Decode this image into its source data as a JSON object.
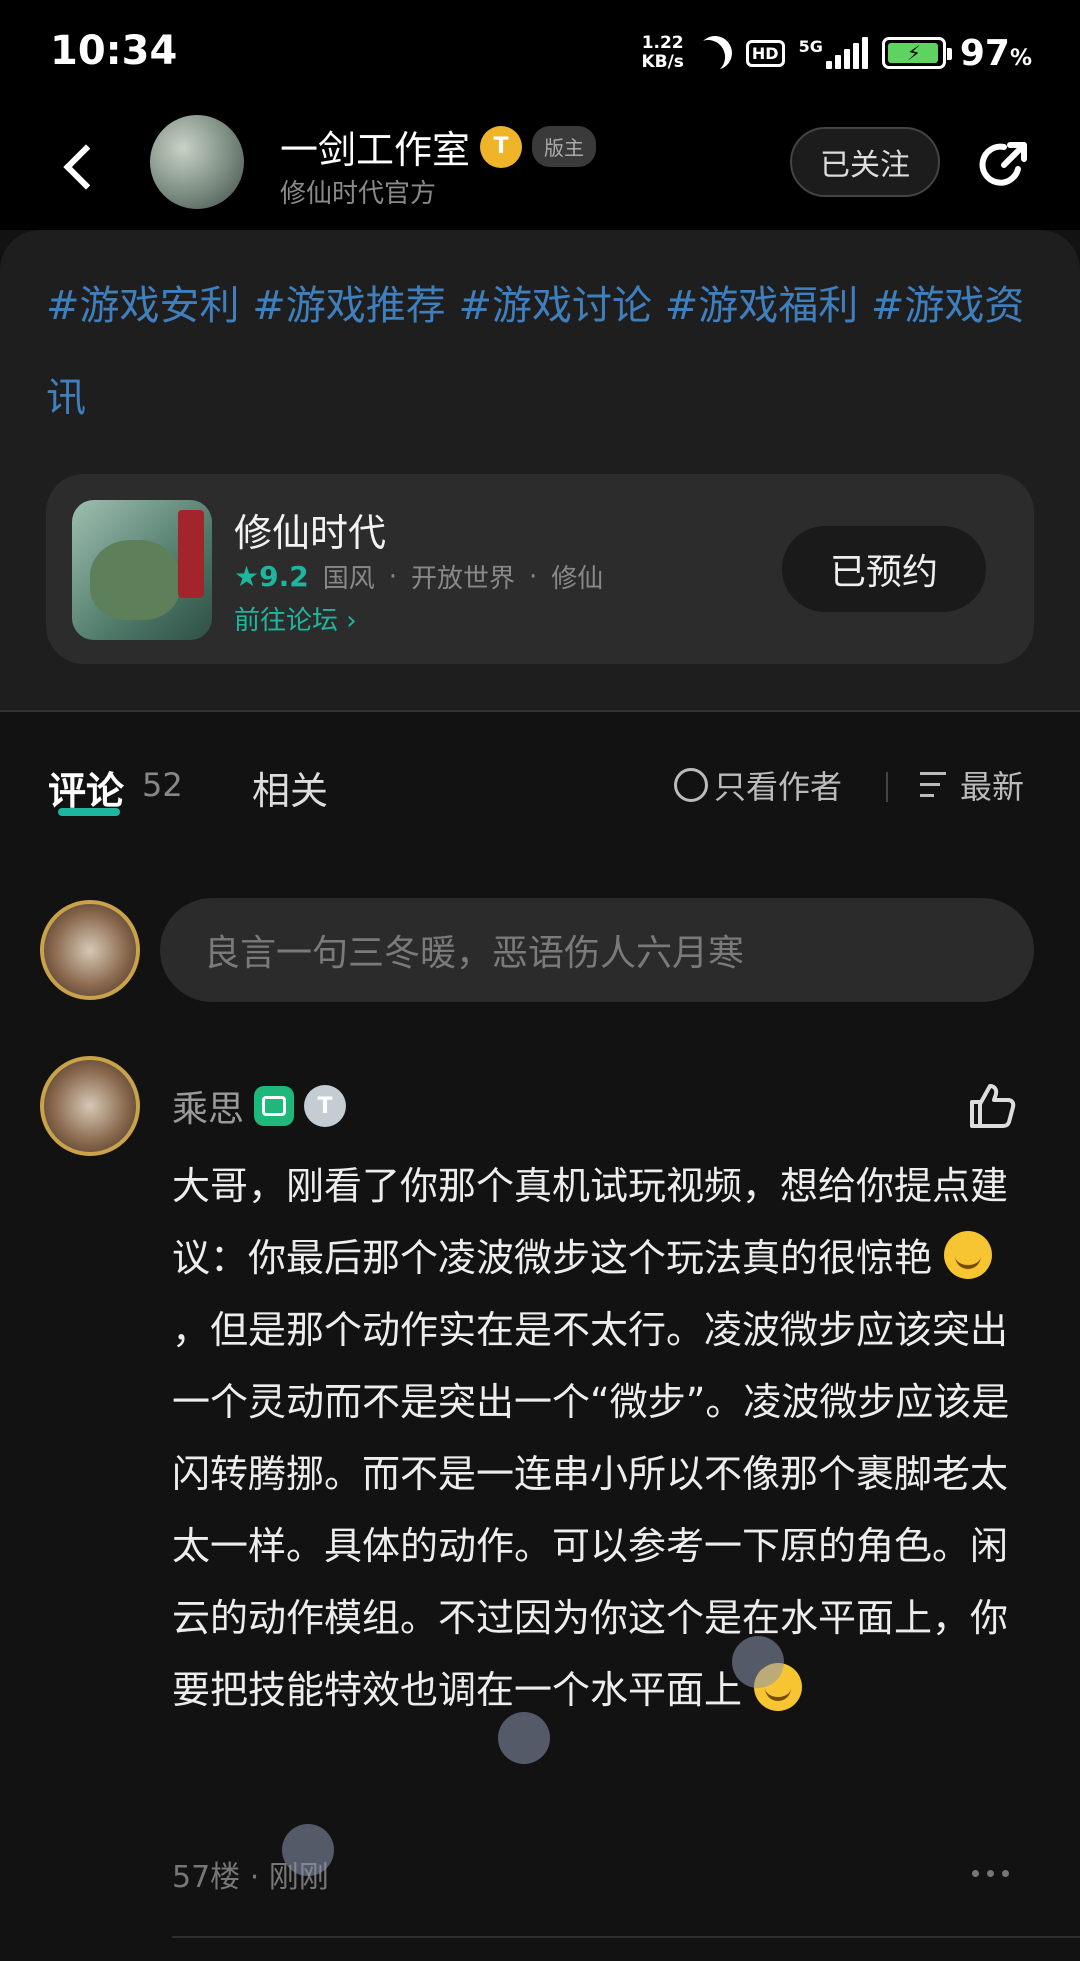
{
  "status_bar": {
    "time": "10:34",
    "net_speed_value": "1.22",
    "net_speed_unit": "KB/s",
    "hd_label": "HD",
    "network_label": "5G",
    "battery_percent": "97",
    "battery_percent_sign": "%",
    "battery_level": 0.97,
    "battery_color": "#5fd35f",
    "icons": [
      "moon-icon",
      "hd-icon",
      "signal-icon",
      "battery-charging-icon"
    ]
  },
  "header": {
    "author_name": "一剑工作室",
    "verified_badge": "T",
    "role_badge": "版主",
    "subtitle": "修仙时代官方",
    "follow_label": "已关注",
    "icons": [
      "back-arrow-icon",
      "share-icon"
    ]
  },
  "post": {
    "tags_text": "#游戏安利 #游戏推荐 #游戏讨论 #游戏福利 #游戏资讯",
    "tag_color": "#3f7fbd"
  },
  "game_card": {
    "name": "修仙时代",
    "rating": "9.2",
    "genres": [
      "国风",
      "开放世界",
      "修仙"
    ],
    "forum_link": "前往论坛",
    "reserve_label": "已预约",
    "accent_color": "#1fb6a0"
  },
  "tabs": {
    "comment_label": "评论",
    "comment_count": "52",
    "related_label": "相关",
    "author_only_label": "只看作者",
    "sort_label": "最新"
  },
  "composer": {
    "placeholder": "良言一句三冬暖，恶语伤人六月寒"
  },
  "comment": {
    "author": "乘思",
    "badge_t": "T",
    "body_part1": "大哥，刚看了你那个真机试玩视频，想给你提点建议：你最后那个凌波微步这个玩法真的很惊艳",
    "body_part2": "，但是那个动作实在是不太行。凌波微步应该突出一个灵动而不是突出一个“微步”。凌波微步应该是闪转腾挪。而不是一连串小所以不像那个裹脚老太太一样。具体的动作。可以参考一下原的角色。闲云的动作模组。不过因为你这个是在水平面上，你要把技能特效也调在一个水平面上",
    "floor": "57楼",
    "time": "刚刚",
    "icons": [
      "thumbs-up-icon",
      "more-icon",
      "smile-emoji-icon",
      "happy-emoji-icon"
    ]
  }
}
